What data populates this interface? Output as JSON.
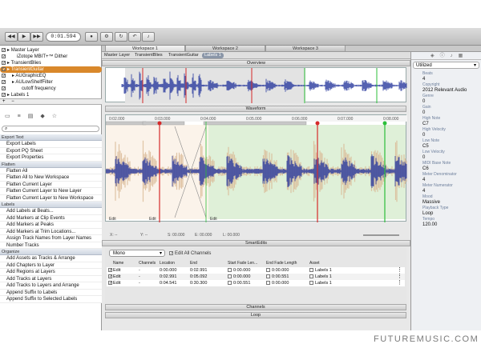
{
  "toolbar": {
    "time": "0:01.594"
  },
  "workspaces": [
    "Workspace 1",
    "Workspace 2",
    "Workspace 3"
  ],
  "crumbs": [
    "Master Layer",
    "TransientBlies",
    "TransientGuitar",
    "Labels 1"
  ],
  "layers": [
    {
      "label": "Master Layer",
      "indent": 0
    },
    {
      "label": "iZotope MBIT+™ Dither",
      "indent": 2
    },
    {
      "label": "TransientBlies",
      "indent": 0
    },
    {
      "label": "TransientGuitar",
      "indent": 0,
      "selected": true
    },
    {
      "label": "AUGraphicEQ",
      "indent": 1
    },
    {
      "label": "AULowShelfFilter",
      "indent": 1
    },
    {
      "label": "cutoff frequency",
      "indent": 3
    },
    {
      "label": "Labels 1",
      "indent": 0
    }
  ],
  "sections": [
    {
      "title": "Export Text",
      "items": [
        "Export Labels",
        "Export PQ Sheet",
        "Export Properties"
      ]
    },
    {
      "title": "Flatten",
      "items": [
        "Flatten All",
        "Flatten All to New Workspace",
        "Flatten Current Layer",
        "Flatten Current Layer to New Layer",
        "Flatten Current Layer to New Workspace"
      ]
    },
    {
      "title": "Labels",
      "items": [
        "Add Labels at Beats...",
        "Add Markers at Clip Events",
        "Add Markers at Peaks",
        "Add Markers at Trim Locations...",
        "Assign Track Names from Layer Names",
        "Number Tracks"
      ]
    },
    {
      "title": "Organize",
      "items": [
        "Add Assets as Tracks & Arrange",
        "Add Chapters to Layer",
        "Add Regions at Layers",
        "Add Tracks at Layers",
        "Add Tracks to Layers and Arrange",
        "Append Suffix to Labels",
        "Append Suffix to Selected Labels"
      ]
    }
  ],
  "panels": {
    "overview": "Overview",
    "waveform": "Waveform",
    "smartedits": "SmartEdits",
    "channels": "Channels",
    "loop": "Loop"
  },
  "ruler": [
    "0:02.000",
    "0:03.000",
    "0:04.000",
    "0:05.000",
    "0:06.000",
    "0:07.000",
    "0:08.000"
  ],
  "ruler_units": "s",
  "clip_labels": [
    "Edit",
    "Edit",
    "Edit"
  ],
  "status": {
    "x": "X: --",
    "y": "Y: --",
    "s": "S: 00.000",
    "e": "E: 00.000",
    "l": "L: 00.000"
  },
  "smartedits": {
    "mode": "Mono",
    "edit_all": "Edit All Channels",
    "headers": [
      "Name",
      "Channels",
      "Location",
      "End",
      "Start Fade Len...",
      "End Fade Length",
      "Asset"
    ],
    "rows": [
      {
        "name": "Edit",
        "channels": "-",
        "location": "0:00.000",
        "end": "0:02.991",
        "start_fade": "0:00.000",
        "end_fade": "0:00.000",
        "asset": "Labels 1"
      },
      {
        "name": "Edit",
        "channels": "-",
        "location": "0:02.991",
        "end": "0:05.092",
        "start_fade": "0:00.000",
        "end_fade": "0:00.551",
        "asset": "Labels 1"
      },
      {
        "name": "Edit",
        "channels": "-",
        "location": "0:04.541",
        "end": "0:30.300",
        "start_fade": "0:00.551",
        "end_fade": "0:00.000",
        "asset": "Labels 1"
      }
    ]
  },
  "inspector": {
    "title": "Utilized",
    "properties": [
      {
        "label": "Beats",
        "value": "4"
      },
      {
        "label": "Copyright",
        "value": "2012 Relevant Audio"
      },
      {
        "label": "Genre",
        "value": "0"
      },
      {
        "label": "Gain",
        "value": "0"
      },
      {
        "label": "High Note",
        "value": "C7"
      },
      {
        "label": "High Velocity",
        "value": "0"
      },
      {
        "label": "Low Note",
        "value": "C5"
      },
      {
        "label": "Low Velocity",
        "value": "0"
      },
      {
        "label": "MIDI Base Note",
        "value": "C6"
      },
      {
        "label": "Meter Denominator",
        "value": "4"
      },
      {
        "label": "Meter Numerator",
        "value": "4"
      },
      {
        "label": "Mood",
        "value": "Massive"
      },
      {
        "label": "Playback Type",
        "value": "Loop"
      },
      {
        "label": "Tempo",
        "value": "120.00"
      }
    ]
  },
  "brand": "FUTUREMUSIC.COM",
  "colors": {
    "selection": "#d9882b",
    "wave_blue": "#2a3a9e",
    "wave_tan": "#d9b893",
    "marker_red": "#d62a2a",
    "marker_green": "#2cbf3a"
  }
}
